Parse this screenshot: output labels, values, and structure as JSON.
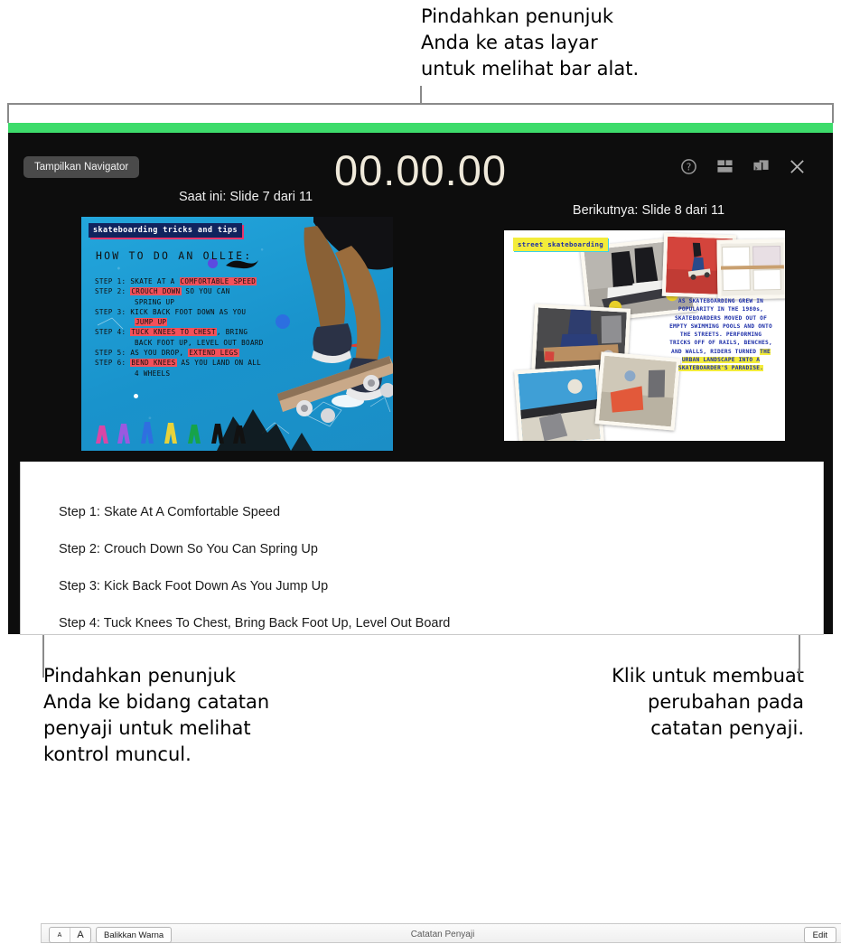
{
  "callouts": {
    "top": "Pindahkan penunjuk\nAnda ke atas layar\nuntuk melihat bar alat.",
    "bottom_left": "Pindahkan penunjuk\nAnda ke bidang catatan\npenyaji untuk melihat\nkontrol muncul.",
    "bottom_right": "Klik untuk membuat\nperubahan pada\ncatatan penyaji."
  },
  "colors": {
    "accent_green": "#3ddc6b",
    "window_background": "#0d0d0d",
    "timer_text": "#efe9da",
    "leader_line": "#8a8a8a"
  },
  "toolbar": {
    "navigator_button": "Tampilkan Navigator",
    "timer": "00.00.00",
    "icons": [
      {
        "name": "help-icon",
        "glyph": "?"
      },
      {
        "name": "layout-icon",
        "glyph": "layout"
      },
      {
        "name": "swap-displays-icon",
        "glyph": "swap"
      },
      {
        "name": "close-icon",
        "glyph": "x"
      }
    ]
  },
  "slides": {
    "current_label": "Saat ini: Slide 7 dari 11",
    "next_label": "Berikutnya: Slide 8 dari 11",
    "current": {
      "title": "skateboarding tricks and tips",
      "heading": "HOW TO DO AN OLLIE:",
      "steps": [
        {
          "label": "STEP 1:",
          "parts": [
            {
              "t": "SKATE AT A ",
              "h": false
            },
            {
              "t": "COMFORTABLE SPEED",
              "h": true
            }
          ]
        },
        {
          "label": "STEP 2:",
          "parts": [
            {
              "t": "CROUCH DOWN",
              "h": true
            },
            {
              "t": " SO YOU CAN",
              "h": false
            }
          ]
        },
        {
          "label": "",
          "parts": [
            {
              "t": "SPRING UP",
              "h": false
            }
          ]
        },
        {
          "label": "STEP 3:",
          "parts": [
            {
              "t": "KICK BACK FOOT DOWN AS YOU",
              "h": false
            }
          ]
        },
        {
          "label": "",
          "parts": [
            {
              "t": "JUMP UP",
              "h": true
            }
          ]
        },
        {
          "label": "STEP 4:",
          "parts": [
            {
              "t": "TUCK KNEES TO CHEST",
              "h": true
            },
            {
              "t": ", BRING",
              "h": false
            }
          ]
        },
        {
          "label": "",
          "parts": [
            {
              "t": "BACK FOOT UP, LEVEL OUT BOARD",
              "h": false
            }
          ]
        },
        {
          "label": "STEP 5:",
          "parts": [
            {
              "t": "AS YOU DROP, ",
              "h": false
            },
            {
              "t": "EXTEND LEGS",
              "h": true
            }
          ]
        },
        {
          "label": "STEP 6:",
          "parts": [
            {
              "t": "BEND KNEES",
              "h": true
            },
            {
              "t": " AS YOU LAND ON ALL",
              "h": false
            }
          ]
        },
        {
          "label": "",
          "parts": [
            {
              "t": "4 WHEELS",
              "h": false
            }
          ]
        }
      ]
    },
    "next": {
      "title": "street skateboarding",
      "body_plain": "AS SKATEBOARDING GREW IN POPULARITY IN THE 1980s, SKATEBOARDERS MOVED OUT OF EMPTY SWIMMING POOLS AND ONTO THE STREETS. PERFORMING TRICKS OFF OF RAILS, BENCHES, AND WALLS, RIDERS TURNED ",
      "body_highlight": "THE URBAN LANDSCAPE INTO A SKATEBOARDER'S PARADISE."
    }
  },
  "notes": {
    "font_small_label": "A",
    "font_large_label": "A",
    "invert_colors_label": "Balikkan Warna",
    "title": "Catatan Penyaji",
    "edit_label": "Edit",
    "lines": [
      "Step 1: Skate At A Comfortable Speed",
      "Step 2: Crouch Down So You Can Spring Up",
      "Step 3: Kick Back Foot Down As You Jump Up",
      "Step 4: Tuck Knees To Chest, Bring Back Foot Up, Level Out Board"
    ]
  }
}
